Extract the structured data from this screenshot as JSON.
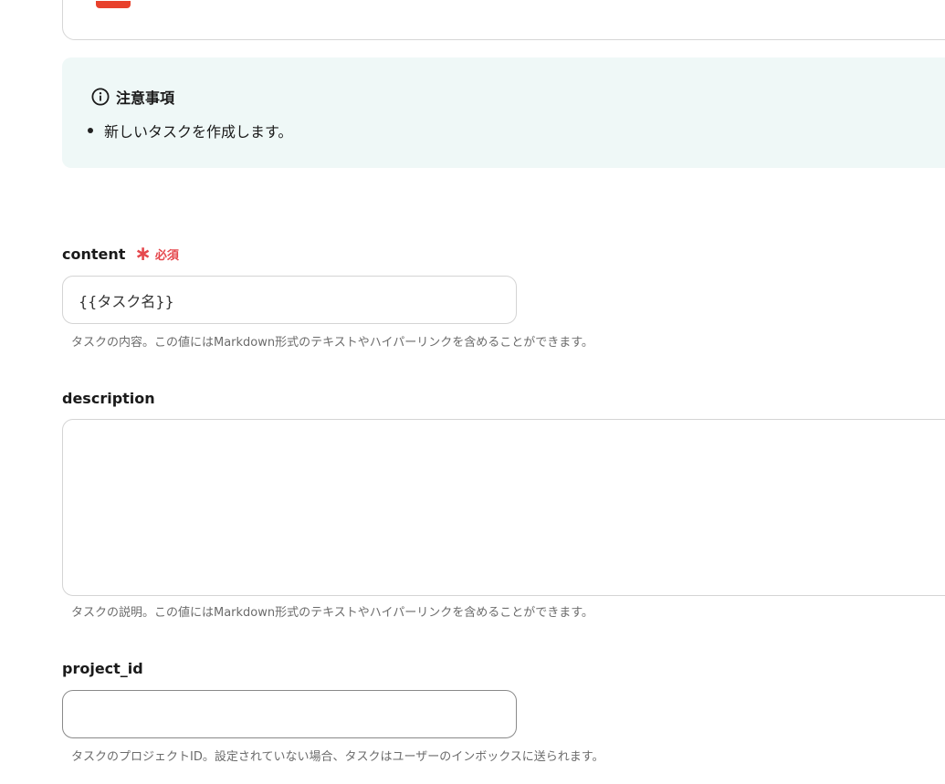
{
  "notice": {
    "title": "注意事項",
    "items": [
      "新しいタスクを作成します。"
    ]
  },
  "fields": {
    "content": {
      "label": "content",
      "required_label": "必須",
      "value": "{{タスク名}}",
      "help": "タスクの内容。この値にはMarkdown形式のテキストやハイパーリンクを含めることができます。"
    },
    "description": {
      "label": "description",
      "value": "",
      "help": "タスクの説明。この値にはMarkdown形式のテキストやハイパーリンクを含めることができます。"
    },
    "project_id": {
      "label": "project_id",
      "value": "",
      "help": "タスクのプロジェクトID。設定されていない場合、タスクはユーザーのインボックスに送られます。"
    }
  },
  "colors": {
    "required": "#e5484d",
    "notice_bg": "#eff8f7",
    "top_badge": "#e8412c"
  }
}
